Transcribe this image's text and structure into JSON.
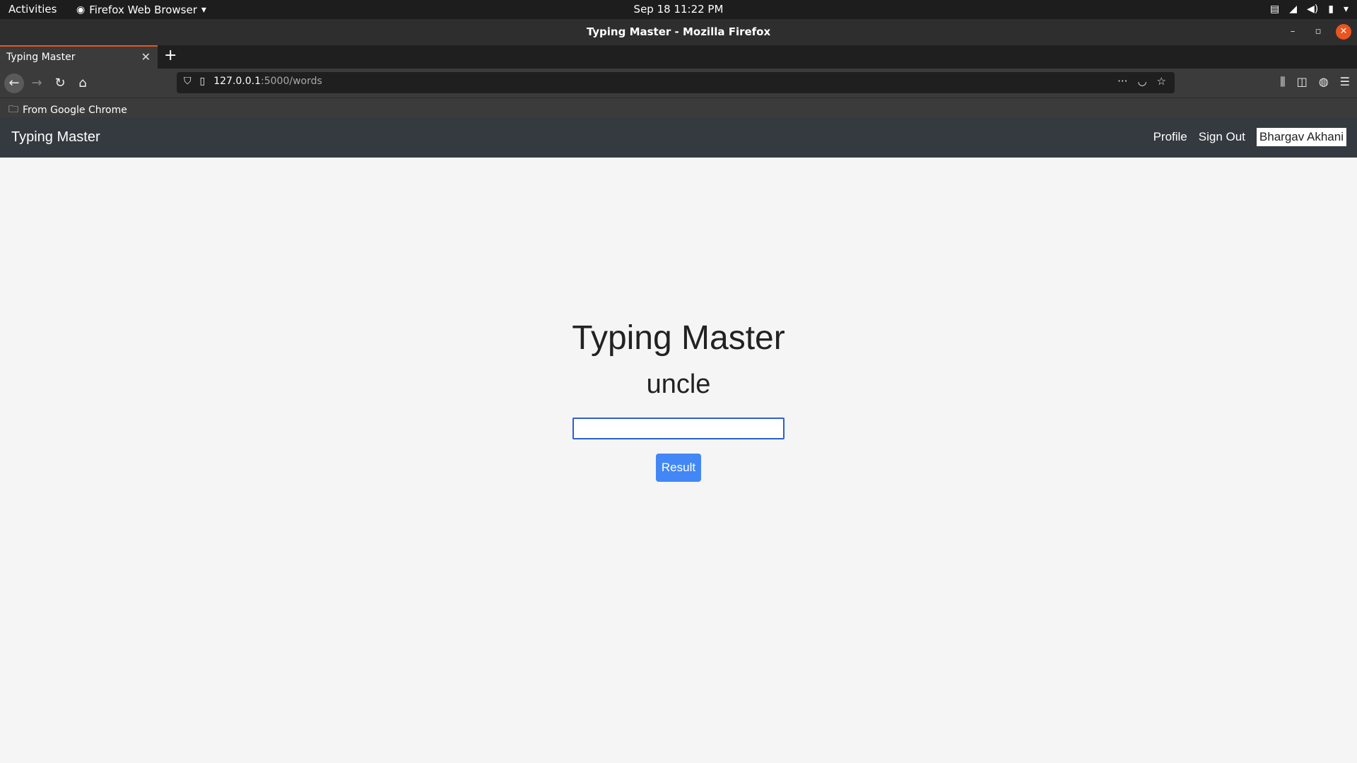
{
  "system": {
    "activities": "Activities",
    "app_menu": "Firefox Web Browser",
    "clock": "Sep 18  11:22 PM"
  },
  "window": {
    "title": "Typing Master - Mozilla Firefox"
  },
  "tab": {
    "label": "Typing Master"
  },
  "url": {
    "host": "127.0.0.1",
    "path": ":5000/words"
  },
  "bookmarks": {
    "folder_label": "From Google Chrome"
  },
  "app_nav": {
    "brand": "Typing Master",
    "profile": "Profile",
    "sign_out": "Sign Out",
    "user": "Bhargav Akhani"
  },
  "main": {
    "heading": "Typing Master",
    "word": "uncle",
    "input_value": "",
    "result_button": "Result"
  },
  "colors": {
    "app_navbar": "#343a40",
    "button_primary": "#4287f5",
    "input_focus_border": "#2b5fd9",
    "tab_accent": "#e95420"
  }
}
